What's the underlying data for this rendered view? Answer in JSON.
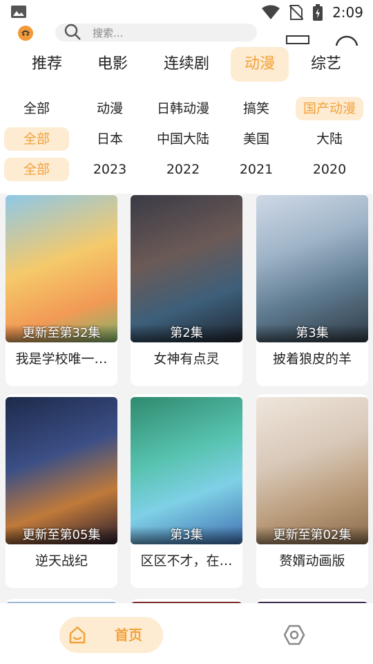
{
  "status_bar": {
    "time": "2:09"
  },
  "search": {
    "placeholder": "搜索..."
  },
  "top_tabs": [
    "推荐",
    "电影",
    "连续剧",
    "动漫",
    "综艺"
  ],
  "filters": {
    "genre": [
      "全部",
      "动漫",
      "日韩动漫",
      "搞笑",
      "国产动漫"
    ],
    "region": [
      "全部",
      "日本",
      "中国大陆",
      "美国",
      "大陆"
    ],
    "year": [
      "全部",
      "2023",
      "2022",
      "2021",
      "2020"
    ]
  },
  "cards": [
    {
      "title": "我是学校唯一…",
      "episode": "更新至第32集"
    },
    {
      "title": "女神有点灵",
      "episode": "第2集"
    },
    {
      "title": "披着狼皮的羊",
      "episode": "第3集"
    },
    {
      "title": "逆天战纪",
      "episode": "更新至第05集"
    },
    {
      "title": "区区不才，在…",
      "episode": "第3集"
    },
    {
      "title": "赘婿动画版",
      "episode": "更新至第02集"
    }
  ],
  "bottom_nav": {
    "home_label": "首页"
  },
  "colors": {
    "accent": "#f2a23a",
    "accent_bg": "#fdebd2",
    "background": "#f3f3f3"
  }
}
